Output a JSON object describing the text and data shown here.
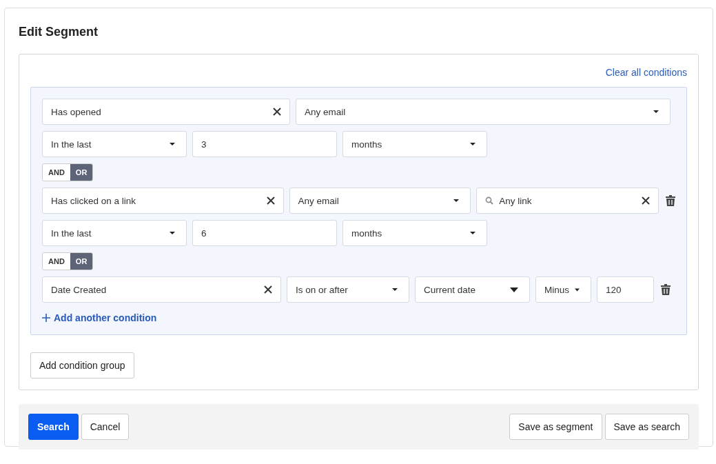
{
  "title": "Edit Segment",
  "clear_all": "Clear all conditions",
  "conditions": [
    {
      "removable": false,
      "rows": [
        [
          {
            "kind": "clearable",
            "value": "Has opened"
          },
          {
            "kind": "select",
            "value": "Any email"
          }
        ],
        [
          {
            "kind": "select",
            "value": "In the last"
          },
          {
            "kind": "input",
            "value": "3"
          },
          {
            "kind": "select",
            "value": "months"
          }
        ]
      ]
    },
    {
      "removable": true,
      "operator": [
        {
          "label": "AND",
          "selected": false
        },
        {
          "label": "OR",
          "selected": true
        }
      ],
      "rows": [
        [
          {
            "kind": "clearable",
            "value": "Has clicked on a link"
          },
          {
            "kind": "select",
            "value": "Any email"
          },
          {
            "kind": "search",
            "value": "Any link"
          }
        ],
        [
          {
            "kind": "select",
            "value": "In the last"
          },
          {
            "kind": "input",
            "value": "6"
          },
          {
            "kind": "select",
            "value": "months"
          }
        ]
      ]
    },
    {
      "removable": true,
      "operator": [
        {
          "label": "AND",
          "selected": false
        },
        {
          "label": "OR",
          "selected": true
        }
      ],
      "rows": [
        [
          {
            "kind": "clearable",
            "value": "Date Created"
          },
          {
            "kind": "select",
            "value": "Is on or after"
          },
          {
            "kind": "dropdown",
            "value": "Current date"
          },
          {
            "kind": "dropdown",
            "value": "Minus"
          },
          {
            "kind": "input",
            "value": "120"
          }
        ]
      ]
    }
  ],
  "add_condition": "Add another condition",
  "add_group": "Add condition group",
  "footer": {
    "left": [
      {
        "label": "Search",
        "primary": true
      },
      {
        "label": "Cancel",
        "primary": false
      }
    ],
    "right": [
      {
        "label": "Save as segment",
        "primary": false
      },
      {
        "label": "Save as search",
        "primary": false
      }
    ]
  }
}
